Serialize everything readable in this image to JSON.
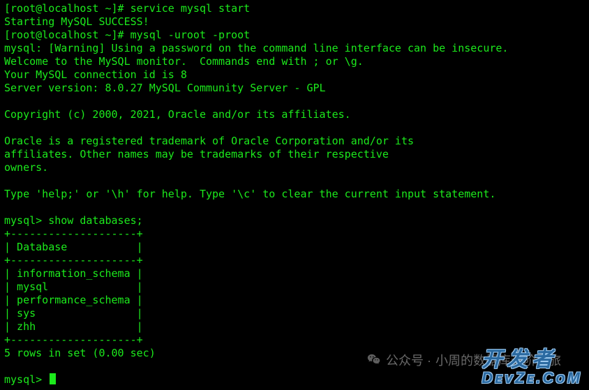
{
  "terminal": {
    "lines": [
      "[root@localhost ~]# service mysql start",
      "Starting MySQL SUCCESS!",
      "[root@localhost ~]# mysql -uroot -proot",
      "mysql: [Warning] Using a password on the command line interface can be insecure.",
      "Welcome to the MySQL monitor.  Commands end with ; or \\g.",
      "Your MySQL connection id is 8",
      "Server version: 8.0.27 MySQL Community Server - GPL",
      "",
      "Copyright (c) 2000, 2021, Oracle and/or its affiliates.",
      "",
      "Oracle is a registered trademark of Oracle Corporation and/or its",
      "affiliates. Other names may be trademarks of their respective",
      "owners.",
      "",
      "Type 'help;' or '\\h' for help. Type '\\c' to clear the current input statement.",
      "",
      "mysql> show databases;",
      "+--------------------+",
      "| Database           |",
      "+--------------------+",
      "| information_schema |",
      "| mysql              |",
      "| performance_schema |",
      "| sys                |",
      "| zhh                |",
      "+--------------------+",
      "5 rows in set (0.00 sec)",
      ""
    ],
    "prompt": "mysql> "
  },
  "watermark": {
    "publisher_prefix": "公众号 · ",
    "publisher_name": "小周的数据库进阶之旅",
    "brand_line1": "开发者",
    "brand_line2": "DᴇᴠZᴇ.CᴏM"
  }
}
